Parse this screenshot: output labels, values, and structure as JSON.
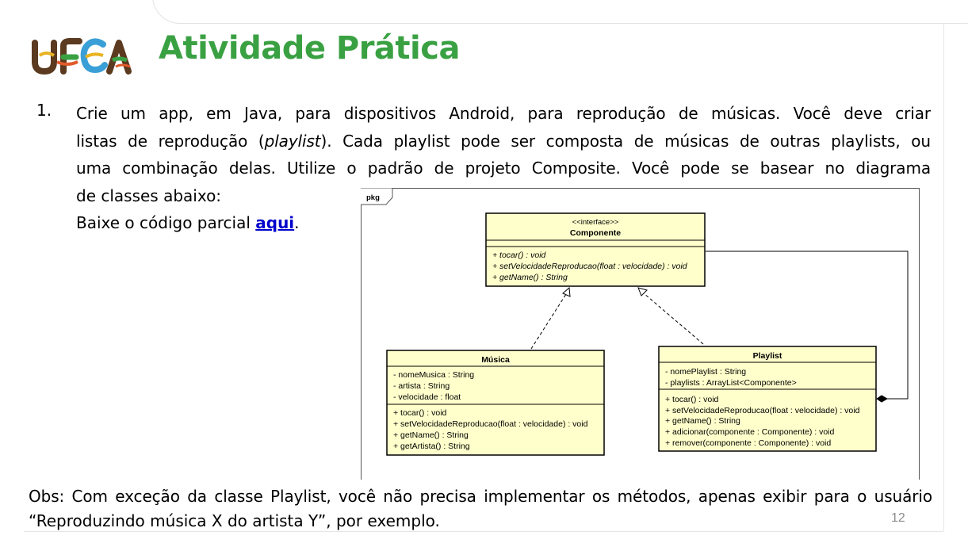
{
  "logo": {
    "text": "UFCA"
  },
  "title": "Atividade Prática",
  "item": {
    "number": "1.",
    "line1": "Crie um app, em Java, para dispositivos Android, para reprodução de músicas. Você deve criar",
    "line2_before": "listas de reprodução (",
    "line2_italic": "playlist",
    "line2_after": "). Cada playlist pode ser composta de músicas de outras playlists, ou",
    "line3": "uma combinação delas. Utilize o padrão de projeto Composite. Você pode se basear no diagrama",
    "line4": "de classes abaixo:",
    "download_prefix": "Baixe o código parcial ",
    "download_link": "aqui",
    "download_suffix": "."
  },
  "diagram": {
    "package_label": "pkg",
    "componente": {
      "stereotype": "<<interface>>",
      "name": "Componente",
      "methods": [
        "+ tocar() : void",
        "+ setVelocidadeReproducao(float : velocidade) : void",
        "+ getName() : String"
      ]
    },
    "musica": {
      "name": "Música",
      "attributes": [
        "- nomeMusica : String",
        "- artista : String",
        "- velocidade : float"
      ],
      "methods": [
        "+ tocar() : void",
        "+ setVelocidadeReproducao(float : velocidade) : void",
        "+ getName() : String",
        "+ getArtista() : String"
      ]
    },
    "playlist": {
      "name": "Playlist",
      "attributes": [
        "- nomePlaylist : String",
        "- playlists : ArrayList<Componente>"
      ],
      "methods": [
        "+ tocar() : void",
        "+ setVelocidadeReproducao(float : velocidade) : void",
        "+ getName() : String",
        "+ adicionar(componente : Componente) : void",
        "+ remover(componente : Componente) : void"
      ]
    },
    "colors": {
      "class_fill": "#ffffcc",
      "border": "#000000"
    }
  },
  "obs": {
    "line1": "Obs: Com exceção da classe Playlist, você não precisa implementar os métodos, apenas exibir para o usuário",
    "line2": "“Reproduzindo música X do artista Y”, por exemplo."
  },
  "page_number": "12",
  "colors": {
    "title": "#3aa143",
    "link": "#0000cc",
    "page_number": "#8c8c8c"
  }
}
